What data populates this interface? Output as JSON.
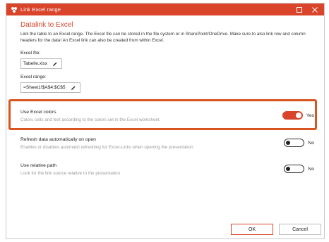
{
  "window": {
    "title": "Link Excel range",
    "accent_color": "#d9442b",
    "icons": [
      "app-icon",
      "maximize-icon",
      "close-icon"
    ]
  },
  "dialog": {
    "heading": "Datalink to Excel",
    "description": "Link the table to an Excel range. The Excel file can be stored in the file system or in SharePoint/OneDrive. Make sure to also link row and column headers for the data!  An Excel link can also be created from within Excel."
  },
  "excel_file": {
    "label": "Excel file:",
    "value": "Tabelle.xlsx",
    "icon": "pencil-icon"
  },
  "excel_range": {
    "label": "Excel range:",
    "value": "=Sheet1!$A$4:$C$5",
    "icon": "pencil-icon"
  },
  "options": [
    {
      "title": "Use Excel colors",
      "description": "Colors cells and text according to the colors set in the Excel worksheet.",
      "state": "Yes"
    },
    {
      "title": "Refresh data automatically on open",
      "description": "Enables or disables automatic refreshing for Excel-Links when opening the presentation.",
      "state": "No"
    },
    {
      "title": "Use relative path",
      "description": "Look for the link source relative to the presentation",
      "state": "No"
    }
  ],
  "buttons": {
    "ok": "OK",
    "cancel": "Cancel"
  }
}
